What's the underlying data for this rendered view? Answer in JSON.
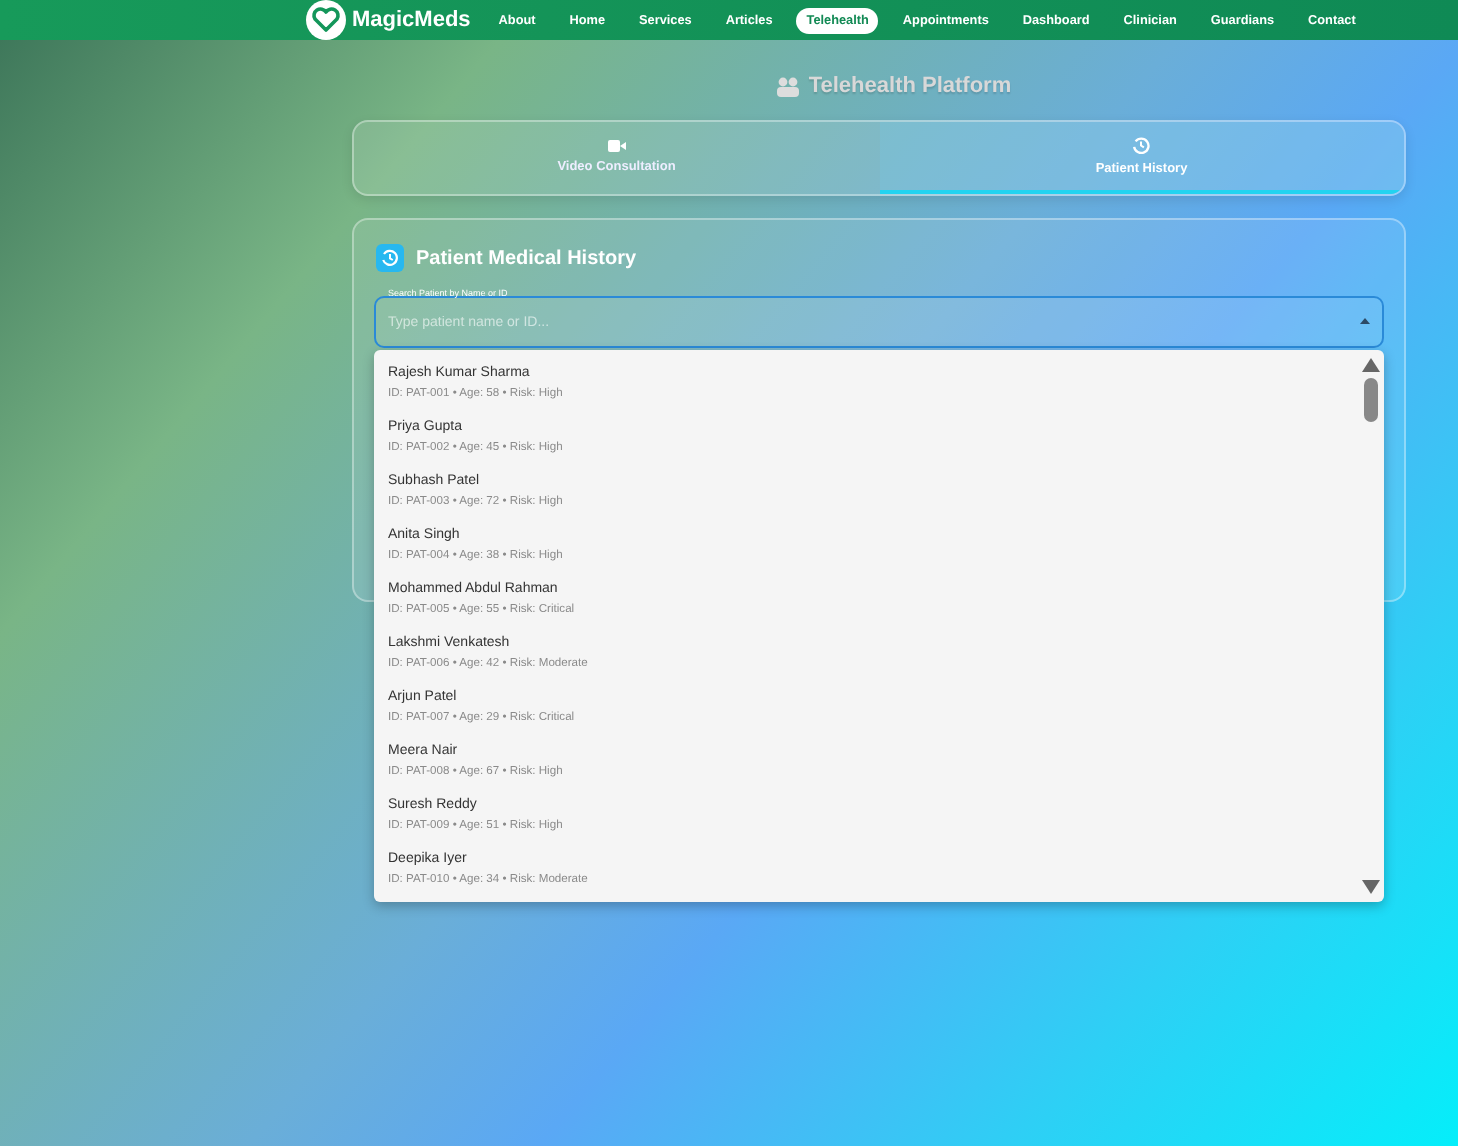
{
  "nav": {
    "brand": "MagicMeds",
    "links": [
      {
        "label": "About",
        "selected": false
      },
      {
        "label": "Home",
        "selected": false
      },
      {
        "label": "Services",
        "selected": false
      },
      {
        "label": "Articles",
        "selected": false
      },
      {
        "label": "Telehealth",
        "selected": true
      },
      {
        "label": "Appointments",
        "selected": false
      },
      {
        "label": "Dashboard",
        "selected": false
      },
      {
        "label": "Clinician",
        "selected": false
      },
      {
        "label": "Guardians",
        "selected": false
      },
      {
        "label": "Contact",
        "selected": false
      }
    ]
  },
  "page_title": "Telehealth Platform",
  "tabs": [
    {
      "label": "Video Consultation",
      "kind": "video",
      "selected": false
    },
    {
      "label": "Patient History",
      "kind": "history",
      "selected": true
    }
  ],
  "panel": {
    "title": "Patient Medical History",
    "search": {
      "label": "Search Patient by Name or ID",
      "placeholder": "Type patient name or ID..."
    },
    "options": [
      {
        "name": "Rajesh Kumar Sharma",
        "detail": "ID: PAT-001 • Age: 58 • Risk: High"
      },
      {
        "name": "Priya Gupta",
        "detail": "ID: PAT-002 • Age: 45 • Risk: High"
      },
      {
        "name": "Subhash Patel",
        "detail": "ID: PAT-003 • Age: 72 • Risk: High"
      },
      {
        "name": "Anita Singh",
        "detail": "ID: PAT-004 • Age: 38 • Risk: High"
      },
      {
        "name": "Mohammed Abdul Rahman",
        "detail": "ID: PAT-005 • Age: 55 • Risk: Critical"
      },
      {
        "name": "Lakshmi Venkatesh",
        "detail": "ID: PAT-006 • Age: 42 • Risk: Moderate"
      },
      {
        "name": "Arjun Patel",
        "detail": "ID: PAT-007 • Age: 29 • Risk: Critical"
      },
      {
        "name": "Meera Nair",
        "detail": "ID: PAT-008 • Age: 67 • Risk: High"
      },
      {
        "name": "Suresh Reddy",
        "detail": "ID: PAT-009 • Age: 51 • Risk: High"
      },
      {
        "name": "Deepika Iyer",
        "detail": "ID: PAT-010 • Age: 34 • Risk: Moderate"
      }
    ]
  }
}
